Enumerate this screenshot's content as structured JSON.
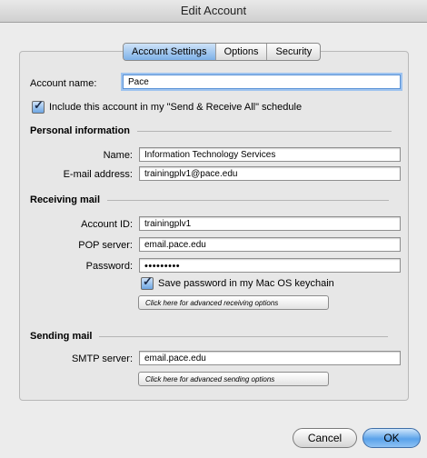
{
  "window": {
    "title": "Edit Account"
  },
  "tabs": [
    {
      "label": "Account Settings"
    },
    {
      "label": "Options"
    },
    {
      "label": "Security"
    }
  ],
  "account": {
    "name_label": "Account name:",
    "name_value": "Pace",
    "include_label": "Include this account in my \"Send & Receive All\" schedule"
  },
  "personal": {
    "header": "Personal information",
    "name_label": "Name:",
    "name_value": "Information Technology Services",
    "email_label": "E-mail address:",
    "email_value": "trainingplv1@pace.edu"
  },
  "receiving": {
    "header": "Receiving mail",
    "account_id_label": "Account ID:",
    "account_id_value": "trainingplv1",
    "pop_label": "POP server:",
    "pop_value": "email.pace.edu",
    "password_label": "Password:",
    "password_value": "•••••••••",
    "save_password_label": "Save password in my Mac OS keychain",
    "advanced_button": "Click here for advanced receiving options"
  },
  "sending": {
    "header": "Sending mail",
    "smtp_label": "SMTP server:",
    "smtp_value": "email.pace.edu",
    "advanced_button": "Click here for advanced sending options"
  },
  "buttons": {
    "cancel": "Cancel",
    "ok": "OK"
  }
}
